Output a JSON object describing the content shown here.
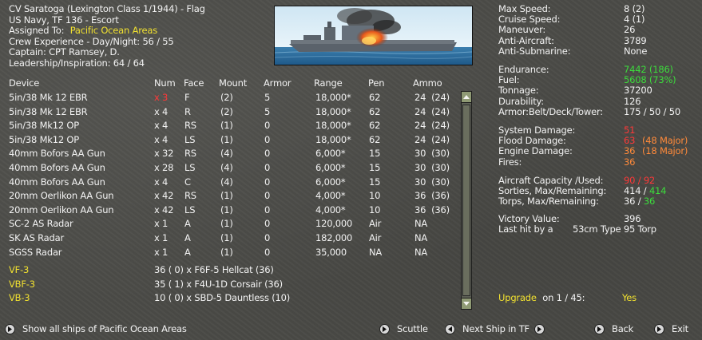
{
  "ship": {
    "title": "CV Saratoga (Lexington Class 1/1944) - Flag",
    "navy": "US Navy, TF 136 - Escort",
    "assigned_label": "Assigned To:",
    "assigned_value": "Pacific Ocean Areas",
    "crew_exp": "Crew Experience - Day/Night: 56 / 55",
    "captain": "Captain: CPT Ramsey, D.",
    "leadership": "Leadership/Inspiration: 64 / 64"
  },
  "table": {
    "headers": [
      "Device",
      "Num",
      "Face",
      "Mount",
      "Armor",
      "Range",
      "Pen",
      "Ammo"
    ],
    "rows": [
      {
        "device": "5in/38 Mk 12 EBR",
        "num": "x 3",
        "face": "F",
        "mount": "(2)",
        "armor": "5",
        "range": "18,000*",
        "pen": "62",
        "ammo": "24  (24)",
        "num_color": "red"
      },
      {
        "device": "5in/38 Mk 12 EBR",
        "num": "x 4",
        "face": "R",
        "mount": "(2)",
        "armor": "5",
        "range": "18,000*",
        "pen": "62",
        "ammo": "24  (24)"
      },
      {
        "device": "5in/38 Mk12 OP",
        "num": "x 4",
        "face": "RS",
        "mount": "(1)",
        "armor": "0",
        "range": "18,000*",
        "pen": "62",
        "ammo": "24  (24)"
      },
      {
        "device": "5in/38 Mk12 OP",
        "num": "x 4",
        "face": "LS",
        "mount": "(1)",
        "armor": "0",
        "range": "18,000*",
        "pen": "62",
        "ammo": "24  (24)"
      },
      {
        "device": "40mm Bofors AA Gun",
        "num": "x 32",
        "face": "RS",
        "mount": "(4)",
        "armor": "0",
        "range": "6,000*",
        "pen": "15",
        "ammo": "30  (30)"
      },
      {
        "device": "40mm Bofors AA Gun",
        "num": "x 28",
        "face": "LS",
        "mount": "(4)",
        "armor": "0",
        "range": "6,000*",
        "pen": "15",
        "ammo": "30  (30)"
      },
      {
        "device": "40mm Bofors AA Gun",
        "num": "x 4",
        "face": "C",
        "mount": "(4)",
        "armor": "0",
        "range": "6,000*",
        "pen": "15",
        "ammo": "30  (30)"
      },
      {
        "device": "20mm Oerlikon AA Gun",
        "num": "x 42",
        "face": "RS",
        "mount": "(1)",
        "armor": "0",
        "range": "4,000*",
        "pen": "10",
        "ammo": "36  (36)"
      },
      {
        "device": "20mm Oerlikon AA Gun",
        "num": "x 42",
        "face": "LS",
        "mount": "(1)",
        "armor": "0",
        "range": "4,000*",
        "pen": "10",
        "ammo": "36  (36)"
      },
      {
        "device": "SC-2 AS Radar",
        "num": "x 1",
        "face": "A",
        "mount": "(1)",
        "armor": "0",
        "range": "120,000",
        "pen": "Air",
        "ammo": "NA"
      },
      {
        "device": "SK AS Radar",
        "num": "x 1",
        "face": "A",
        "mount": "(1)",
        "armor": "0",
        "range": "182,000",
        "pen": "Air",
        "ammo": "NA"
      },
      {
        "device": "SGSS Radar",
        "num": "x 1",
        "face": "A",
        "mount": "(1)",
        "armor": "0",
        "range": "35,000",
        "pen": "NA",
        "ammo": "NA"
      }
    ]
  },
  "air_groups": [
    {
      "name": "VF-3",
      "desc": "36 ( 0) x F6F-5 Hellcat (36)"
    },
    {
      "name": "VBF-3",
      "desc": "35 ( 1) x F4U-1D Corsair (36)"
    },
    {
      "name": "VB-3",
      "desc": "10 ( 0) x SBD-5 Dauntless (10)"
    }
  ],
  "stats": {
    "group1": [
      {
        "label": "Max Speed:",
        "value": "8 (2)"
      },
      {
        "label": "Cruise Speed:",
        "value": "4 (1)"
      },
      {
        "label": "Maneuver:",
        "value": "26"
      },
      {
        "label": "Anti-Aircraft:",
        "value": "3789"
      },
      {
        "label": "Anti-Submarine:",
        "value": "None"
      }
    ],
    "group2": [
      {
        "label": "Endurance:",
        "value": "7442 (186)",
        "color": "green"
      },
      {
        "label": "Fuel:",
        "value": "5608 (73%)",
        "color": "green"
      },
      {
        "label": "Tonnage:",
        "value": "37200"
      },
      {
        "label": "Durability:",
        "value": "126"
      },
      {
        "label": "Armor:Belt/Deck/Tower:",
        "value": "175 / 50 / 50"
      }
    ],
    "group3": [
      {
        "label": "System Damage:",
        "value": "51",
        "color": "red"
      },
      {
        "label": "Flood Damage:",
        "value": "63",
        "color": "red",
        "extra": "(48 Major)"
      },
      {
        "label": "Engine Damage:",
        "value": "36",
        "color": "orange",
        "extra": "(18 Major)"
      },
      {
        "label": "Fires:",
        "value": "36",
        "color": "orange"
      }
    ],
    "aircraft_capacity": {
      "label": "Aircraft Capacity /Used:",
      "value": "90 / 92"
    },
    "sorties": {
      "label": "Sorties, Max/Remaining:",
      "value_a": "414 / ",
      "value_b": "414"
    },
    "torps": {
      "label": "Torps, Max/Remaining:",
      "value_a": "36 / ",
      "value_b": "36"
    },
    "victory": {
      "label": "Victory Value:",
      "value": "396"
    },
    "last_hit": {
      "label": "Last hit by a",
      "value": "53cm Type 95 Torp"
    }
  },
  "upgrade": {
    "label": "Upgrade",
    "text": "on 1 / 45:",
    "value": "Yes"
  },
  "buttons": {
    "show_all": "Show all ships of Pacific Ocean Areas",
    "scuttle": "Scuttle",
    "next_ship": "Next Ship in TF",
    "back": "Back",
    "exit": "Exit"
  },
  "colors": {
    "yellow": "#f0e030",
    "green": "#3cdc3c",
    "red": "#ff3838",
    "orange": "#ff8a3a"
  }
}
